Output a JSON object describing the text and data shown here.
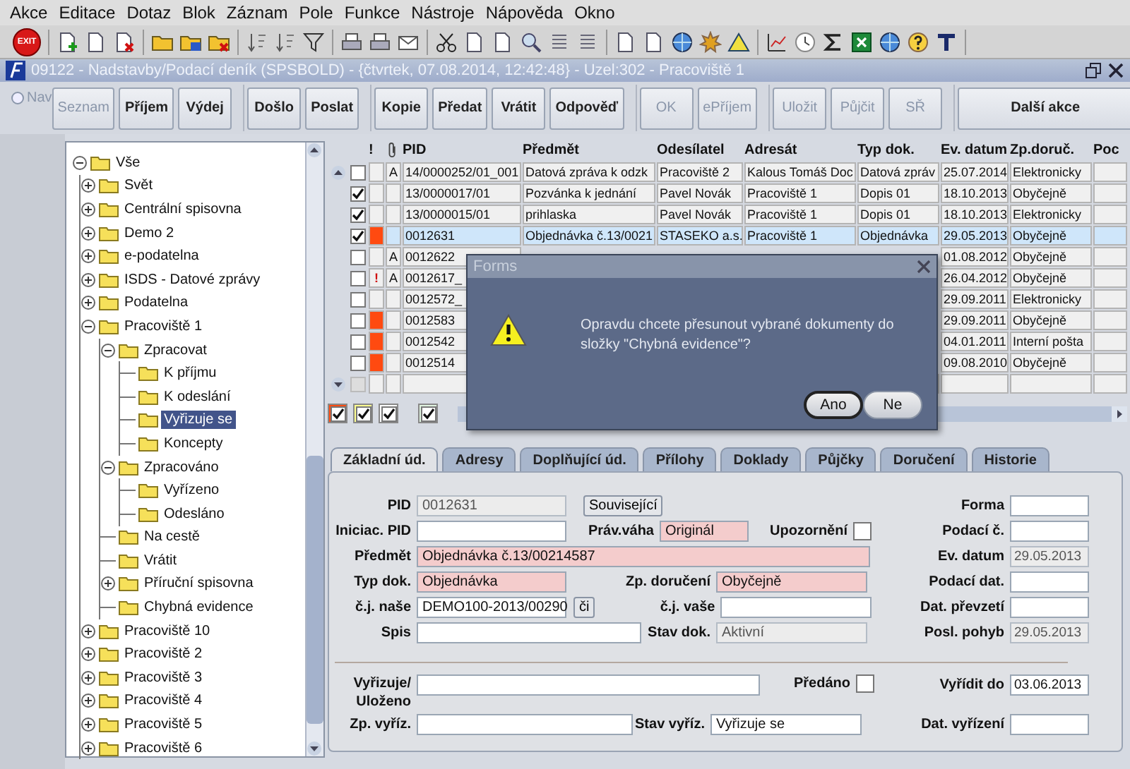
{
  "menu": [
    "Akce",
    "Editace",
    "Dotaz",
    "Blok",
    "Záznam",
    "Pole",
    "Funkce",
    "Nástroje",
    "Nápověda",
    "Okno"
  ],
  "toolbar": {
    "exit_label": "EXIT"
  },
  "window": {
    "title": "09122 - Nadstavby/Podací deník (SPSBOLD) - {čtvrtek, 07.08.2014, 12:42:48} - Uzel:302 - Pracoviště 1"
  },
  "nav": {
    "label": "Nav",
    "selected": false
  },
  "action_groups": [
    [
      {
        "label": "Seznam",
        "disabled": true
      },
      {
        "label": "Příjem",
        "disabled": false
      },
      {
        "label": "Výdej",
        "disabled": false
      }
    ],
    [
      {
        "label": "Došlo",
        "disabled": false
      },
      {
        "label": "Poslat",
        "disabled": false
      }
    ],
    [
      {
        "label": "Kopie",
        "disabled": false
      },
      {
        "label": "Předat",
        "disabled": false
      },
      {
        "label": "Vrátit",
        "disabled": false
      },
      {
        "label": "Odpověď",
        "disabled": false
      }
    ],
    [
      {
        "label": "OK",
        "disabled": true
      },
      {
        "label": "ePříjem",
        "disabled": true
      }
    ],
    [
      {
        "label": "Uložit",
        "disabled": true
      },
      {
        "label": "Půjčit",
        "disabled": true
      },
      {
        "label": "SŘ",
        "disabled": true
      }
    ],
    [
      {
        "label": "Další akce",
        "disabled": false
      }
    ]
  ],
  "tree": [
    {
      "label": "Vše",
      "expanded": true,
      "selected": false,
      "children": [
        {
          "label": "Svět",
          "expanded": false,
          "selected": false
        },
        {
          "label": "Centrální spisovna",
          "expanded": false,
          "selected": false
        },
        {
          "label": "Demo 2",
          "expanded": false,
          "selected": false
        },
        {
          "label": "e-podatelna",
          "expanded": false,
          "selected": false
        },
        {
          "label": "ISDS - Datové zprávy",
          "expanded": false,
          "selected": false
        },
        {
          "label": "Podatelna",
          "expanded": false,
          "selected": false
        },
        {
          "label": "Pracoviště 1",
          "expanded": true,
          "selected": false,
          "children": [
            {
              "label": "Zpracovat",
              "expanded": true,
              "selected": false,
              "children": [
                {
                  "label": "K příjmu",
                  "selected": false
                },
                {
                  "label": "K odeslání",
                  "selected": false
                },
                {
                  "label": "Vyřizuje se",
                  "selected": true
                },
                {
                  "label": "Koncepty",
                  "selected": false
                }
              ]
            },
            {
              "label": "Zpracováno",
              "expanded": true,
              "selected": false,
              "children": [
                {
                  "label": "Vyřízeno",
                  "selected": false
                },
                {
                  "label": "Odesláno",
                  "selected": false
                }
              ]
            },
            {
              "label": "Na cestě",
              "selected": false
            },
            {
              "label": "Vrátit",
              "selected": false
            },
            {
              "label": "Příruční spisovna",
              "expanded": false,
              "selected": false
            },
            {
              "label": "Chybná evidence",
              "selected": false
            }
          ]
        },
        {
          "label": "Pracoviště 10",
          "expanded": false,
          "selected": false
        },
        {
          "label": "Pracoviště 2",
          "expanded": false,
          "selected": false
        },
        {
          "label": "Pracoviště 3",
          "expanded": false,
          "selected": false
        },
        {
          "label": "Pracoviště 4",
          "expanded": false,
          "selected": false
        },
        {
          "label": "Pracoviště 5",
          "expanded": false,
          "selected": false
        },
        {
          "label": "Pracoviště 6",
          "expanded": false,
          "selected": false
        }
      ]
    }
  ],
  "table": {
    "columns": [
      "!",
      "PID",
      "Předmět",
      "Odesílatel",
      "Adresát",
      "Typ dok.",
      "Ev. datum",
      "Zp.doruč.",
      "Poc"
    ],
    "rows": [
      {
        "checked": false,
        "selected": false,
        "attach": "A",
        "pid": "14/0000252/01_001",
        "subject": "Datová zpráva k odzk",
        "sender": "Pracoviště 2",
        "recipient": "Kalous Tomáš Doc",
        "doc_type": "Datová zpráv",
        "ev_date": "25.07.2014",
        "delivery": "Elektronicky"
      },
      {
        "checked": true,
        "selected": false,
        "pid": "13/0000017/01",
        "subject": "Pozvánka k jednání",
        "sender": "Pavel Novák",
        "recipient": "Pracoviště 1",
        "doc_type": "Dopis 01",
        "ev_date": "18.10.2013",
        "delivery": "Obyčejně"
      },
      {
        "checked": true,
        "selected": false,
        "pid": "13/0000015/01",
        "subject": "prihlaska",
        "sender": "Pavel Novák",
        "recipient": "Pracoviště 1",
        "doc_type": "Dopis 01",
        "ev_date": "18.10.2013",
        "delivery": "Elektronicky"
      },
      {
        "checked": true,
        "selected": true,
        "color": "#ff4a10",
        "pid": "0012631",
        "subject": "Objednávka č.13/0021",
        "sender": "STASEKO a.s.",
        "recipient": "Pracoviště 1",
        "doc_type": "Objednávka",
        "ev_date": "29.05.2013",
        "delivery": "Obyčejně"
      },
      {
        "checked": false,
        "selected": false,
        "attach": "A",
        "pid": "0012622",
        "ev_date": "01.08.2012",
        "delivery": "Obyčejně"
      },
      {
        "checked": false,
        "selected": false,
        "priority": "!",
        "attach": "A",
        "pid": "0012617_",
        "ev_date": "26.04.2012",
        "delivery": "Obyčejně"
      },
      {
        "checked": false,
        "selected": false,
        "pid": "0012572_",
        "ev_date": "29.09.2011",
        "delivery": "Elektronicky"
      },
      {
        "checked": false,
        "selected": false,
        "color": "#ff4a10",
        "pid": "0012583",
        "ev_date": "29.09.2011",
        "delivery": "Obyčejně"
      },
      {
        "checked": false,
        "selected": false,
        "color": "#ff4a10",
        "pid": "0012542",
        "ev_date": "04.01.2011",
        "delivery": "Interní pošta"
      },
      {
        "checked": false,
        "selected": false,
        "color": "#ff4a10",
        "pid": "0012514",
        "ev_date": "09.08.2010",
        "delivery": "Obyčejně"
      }
    ]
  },
  "legend": [
    {
      "color": "#ff4a10",
      "checked": true
    },
    {
      "color": "#ffff90",
      "checked": true
    },
    {
      "color": "#ffffff",
      "checked": true
    },
    {
      "color": "#e0f4e0",
      "checked": true
    }
  ],
  "tabs": [
    {
      "label": "Základní úd.",
      "selected": true
    },
    {
      "label": "Adresy",
      "selected": false
    },
    {
      "label": "Doplňující úd.",
      "selected": false
    },
    {
      "label": "Přílohy",
      "selected": false
    },
    {
      "label": "Doklady",
      "selected": false
    },
    {
      "label": "Půjčky",
      "selected": false
    },
    {
      "label": "Doručení",
      "selected": false
    },
    {
      "label": "Historie",
      "selected": false
    }
  ],
  "form": {
    "pid": {
      "label": "PID",
      "value": "0012631",
      "required": false,
      "readonly": true
    },
    "related_button": "Související",
    "forma": {
      "label": "Forma",
      "required": false,
      "readonly": false
    },
    "init_pid": {
      "label": "Iniciac. PID",
      "required": false,
      "readonly": false
    },
    "legal_weight": {
      "label": "Práv.váha",
      "value": "Originál",
      "required": true,
      "readonly": false
    },
    "notice": {
      "label": "Upozornění",
      "checked": false
    },
    "filing_no": {
      "label": "Podací č.",
      "required": false,
      "readonly": false
    },
    "subject": {
      "label": "Předmět",
      "value": "Objednávka č.13/00214587",
      "required": true,
      "readonly": false
    },
    "ev_date": {
      "label": "Ev. datum",
      "value": "29.05.2013",
      "required": false,
      "readonly": true
    },
    "doc_type": {
      "label": "Typ dok.",
      "value": "Objednávka",
      "required": true,
      "readonly": false
    },
    "delivery": {
      "label": "Zp. doručení",
      "value": "Obyčejně",
      "required": true,
      "readonly": false
    },
    "filing_date": {
      "label": "Podací dat.",
      "required": false,
      "readonly": false
    },
    "our_ref": {
      "label": "č.j. naše",
      "value": "DEMO100-2013/00290",
      "required": false,
      "readonly": false
    },
    "ref_button": "či",
    "their_ref": {
      "label": "č.j. vaše",
      "required": false,
      "readonly": false
    },
    "takeover_date": {
      "label": "Dat. převzetí",
      "required": false,
      "readonly": false
    },
    "file": {
      "label": "Spis",
      "required": false,
      "readonly": false
    },
    "doc_state": {
      "label": "Stav dok.",
      "value": "Aktivní",
      "required": false,
      "readonly": true
    },
    "last_move": {
      "label": "Posl. pohyb",
      "value": "29.05.2013",
      "required": false,
      "readonly": true
    },
    "handler": {
      "label": "Vyřizuje/ Uloženo",
      "required": false,
      "readonly": false
    },
    "handed": {
      "label": "Předáno",
      "checked": false
    },
    "due": {
      "label": "Vyřídit do",
      "value": "03.06.2013",
      "required": false,
      "readonly": false
    },
    "settle_mode": {
      "label": "Zp. vyříz.",
      "required": false,
      "readonly": false
    },
    "settle_state": {
      "label": "Stav vyříz.",
      "value": "Vyřizuje se",
      "required": false,
      "readonly": false
    },
    "settle_date": {
      "label": "Dat. vyřízení",
      "required": false,
      "readonly": false
    }
  },
  "dialog": {
    "title": "Forms",
    "message": "Opravdu chcete přesunout vybrané dokumenty do složky \"Chybná evidence\"?",
    "buttons": [
      {
        "label": "Ano",
        "default": true
      },
      {
        "label": "Ne",
        "default": false
      }
    ]
  }
}
